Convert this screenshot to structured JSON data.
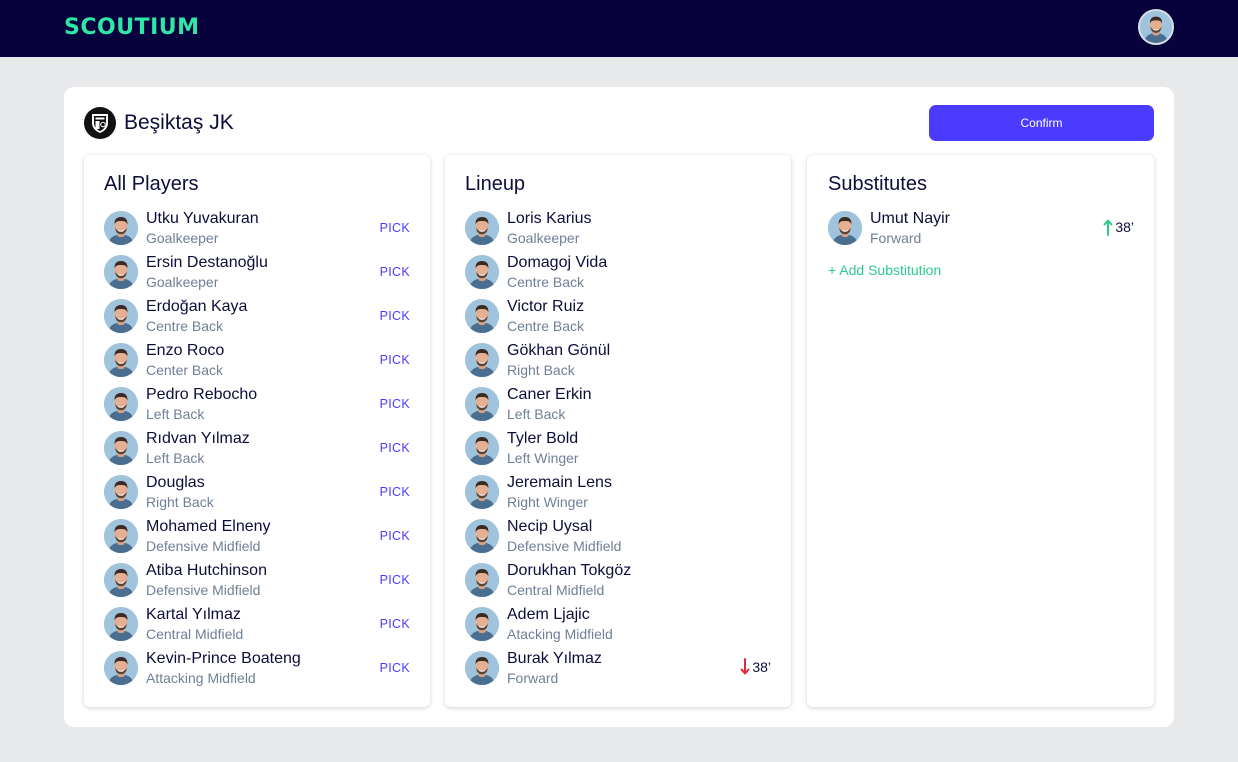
{
  "app": {
    "logo_text": "SCOUTIUM"
  },
  "team": {
    "name": "Beşiktaş JK"
  },
  "actions": {
    "confirm_label": "Confirm"
  },
  "colors": {
    "topbar": "#07023c",
    "brand_green": "#2ee6a6",
    "accent": "#4b3bff",
    "sub_in": "#2ec98e",
    "sub_out": "#e5263f"
  },
  "panels": {
    "all_players": {
      "title": "All Players",
      "pick_label": "PICK",
      "items": [
        {
          "name": "Utku Yuvakuran",
          "position": "Goalkeeper"
        },
        {
          "name": "Ersin Destanoğlu",
          "position": "Goalkeeper"
        },
        {
          "name": "Erdoğan Kaya",
          "position": "Centre Back"
        },
        {
          "name": "Enzo Roco",
          "position": "Center Back"
        },
        {
          "name": "Pedro Rebocho",
          "position": "Left Back"
        },
        {
          "name": "Rıdvan Yılmaz",
          "position": "Left Back"
        },
        {
          "name": "Douglas",
          "position": "Right Back"
        },
        {
          "name": "Mohamed Elneny",
          "position": "Defensive Midfield"
        },
        {
          "name": "Atiba Hutchinson",
          "position": "Defensive Midfield"
        },
        {
          "name": "Kartal Yılmaz",
          "position": "Central Midfield"
        },
        {
          "name": "Kevin-Prince Boateng",
          "position": "Attacking Midfield"
        }
      ]
    },
    "lineup": {
      "title": "Lineup",
      "items": [
        {
          "name": "Loris Karius",
          "position": "Goalkeeper"
        },
        {
          "name": "Domagoj Vida",
          "position": "Centre Back"
        },
        {
          "name": "Victor Ruiz",
          "position": "Centre Back"
        },
        {
          "name": "Gökhan Gönül",
          "position": "Right Back"
        },
        {
          "name": "Caner Erkin",
          "position": "Left Back"
        },
        {
          "name": "Tyler Bold",
          "position": "Left Winger"
        },
        {
          "name": "Jeremain Lens",
          "position": "Right Winger"
        },
        {
          "name": "Necip Uysal",
          "position": "Defensive Midfield"
        },
        {
          "name": "Dorukhan Tokgöz",
          "position": "Central Midfield"
        },
        {
          "name": "Adem Ljajic",
          "position": "Atacking Midfield"
        },
        {
          "name": "Burak Yılmaz",
          "position": "Forward",
          "sub_minute": "38’",
          "sub_icon": "arrow-down-icon"
        }
      ]
    },
    "substitutes": {
      "title": "Substitutes",
      "items": [
        {
          "name": "Umut Nayir",
          "position": "Forward",
          "sub_minute": "38’",
          "sub_icon": "arrow-up-icon"
        }
      ],
      "add_label": "+ Add Substitution"
    }
  }
}
